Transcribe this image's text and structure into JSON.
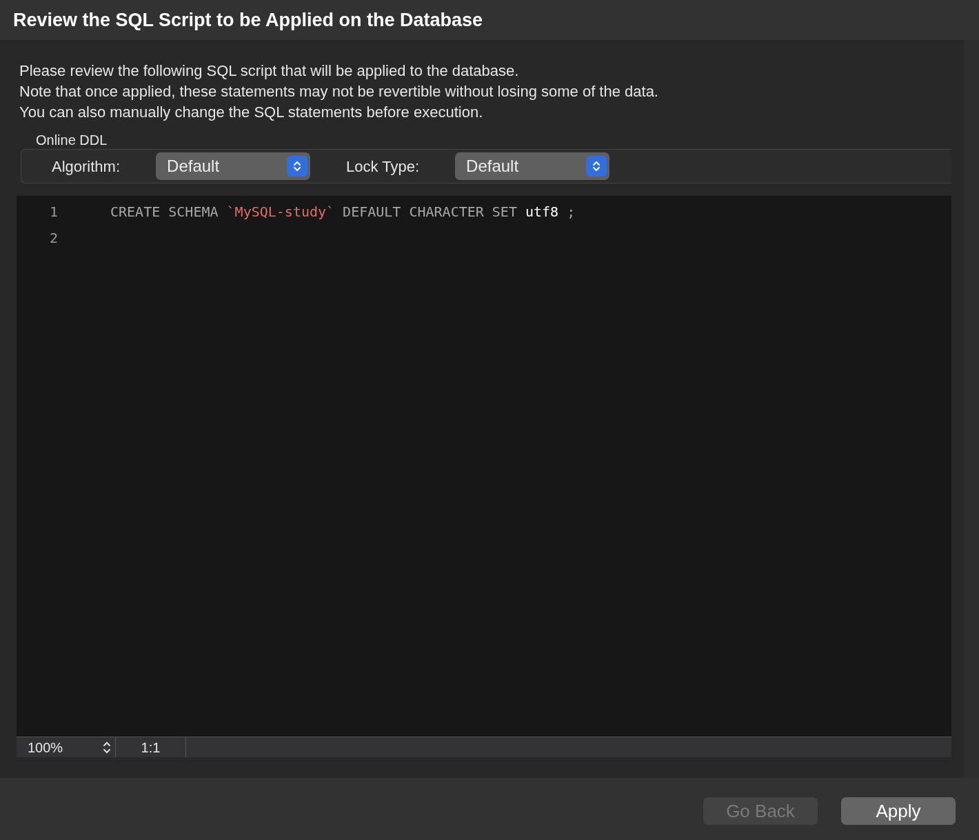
{
  "window": {
    "title": "Review the SQL Script to be Applied on the Database"
  },
  "description": [
    "Please review the following SQL script that will be applied to the database.",
    "Note that once applied, these statements may not be revertible without losing some of the data.",
    "You can also manually change the SQL statements before execution."
  ],
  "online_ddl": {
    "title": "Online DDL",
    "fields": [
      {
        "label": "Algorithm:",
        "value": "Default"
      },
      {
        "label": "Lock Type:",
        "value": "Default"
      }
    ]
  },
  "editor": {
    "lines": [
      {
        "number": "1",
        "tokens": [
          {
            "kind": "keyword",
            "text": "CREATE SCHEMA"
          },
          {
            "kind": "string",
            "text": "`MySQL-study`"
          },
          {
            "kind": "keyword",
            "text": "DEFAULT CHARACTER SET"
          },
          {
            "kind": "identifier",
            "text": "utf8"
          },
          {
            "kind": "keyword",
            "text": ";"
          }
        ]
      },
      {
        "number": "2"
      }
    ],
    "status_bar": {
      "zoom": "100%",
      "position": "1:1"
    }
  },
  "buttons": [
    {
      "label": "Go Back",
      "disabled": true
    },
    {
      "label": "Apply",
      "disabled": false
    }
  ]
}
